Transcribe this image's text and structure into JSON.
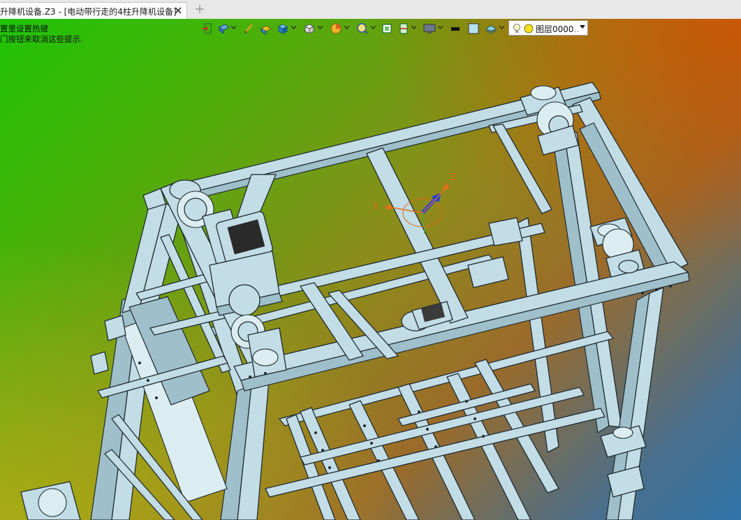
{
  "tab": {
    "title": "升降机设备.Z3 - [电动带行走的4柱升降机设备]",
    "close_symbol": "✕",
    "new_symbol": "+"
  },
  "viewport": {
    "hint_line1": "置里设置热键",
    "hint_line2": "门按钮来取消这些提示."
  },
  "toolbar": {
    "layer_value": "图层0000",
    "layer_overflow": ".."
  },
  "triad": {
    "x_label": "X",
    "z_label": "Z"
  },
  "icons": [
    "exit-icon",
    "view-style-icon",
    "pencil-icon",
    "render-icon",
    "cube-icon",
    "white-cube-icon",
    "pie-icon",
    "zoom-icon",
    "fit-icon",
    "section-icon",
    "display-icon",
    "color-swatch-icon",
    "fill-swatch-icon",
    "layer-icon",
    "bulb-icon",
    "layer-dot-icon"
  ],
  "colors": {
    "steel": "#c3dde6",
    "steel_edge": "#1e2a30",
    "triad_z": "#1b3fe0",
    "triad_x": "#e0701b"
  }
}
